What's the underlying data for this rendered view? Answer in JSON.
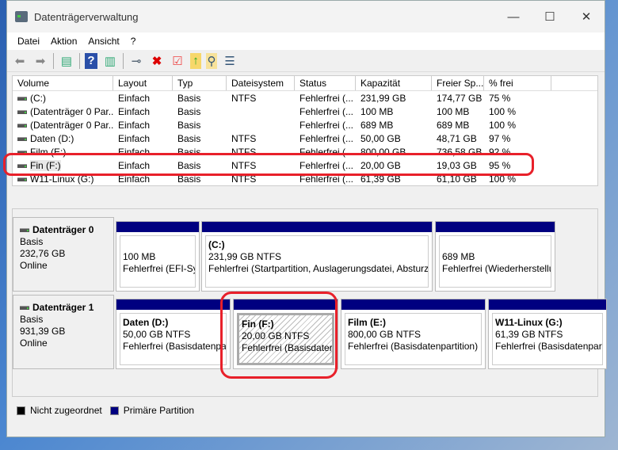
{
  "window": {
    "title": "Datenträgerverwaltung",
    "minimize": "—",
    "maximize": "☐",
    "close": "✕"
  },
  "menu": [
    "Datei",
    "Aktion",
    "Ansicht",
    "?"
  ],
  "toolbar": [
    "back-icon",
    "forward-icon",
    "show-pane-icon",
    "help-icon",
    "show-pane-right-icon",
    "connect-disk-icon",
    "delete-icon",
    "properties-icon",
    "folder-up-icon",
    "search-folder-icon",
    "checklist-icon"
  ],
  "columns": [
    "Volume",
    "Layout",
    "Typ",
    "Dateisystem",
    "Status",
    "Kapazität",
    "Freier Sp...",
    "% frei"
  ],
  "volumes": [
    [
      "(C:)",
      "Einfach",
      "Basis",
      "NTFS",
      "Fehlerfrei (...",
      "231,99 GB",
      "174,77 GB",
      "75 %"
    ],
    [
      "(Datenträger 0 Par...",
      "Einfach",
      "Basis",
      "",
      "Fehlerfrei (...",
      "100 MB",
      "100 MB",
      "100 %"
    ],
    [
      "(Datenträger 0 Par...",
      "Einfach",
      "Basis",
      "",
      "Fehlerfrei (...",
      "689 MB",
      "689 MB",
      "100 %"
    ],
    [
      "Daten (D:)",
      "Einfach",
      "Basis",
      "NTFS",
      "Fehlerfrei (...",
      "50,00 GB",
      "48,71 GB",
      "97 %"
    ],
    [
      "Film (E:)",
      "Einfach",
      "Basis",
      "NTFS",
      "Fehlerfrei (...",
      "800,00 GB",
      "736,58 GB",
      "92 %"
    ],
    [
      "Fin (F:)",
      "Einfach",
      "Basis",
      "NTFS",
      "Fehlerfrei (...",
      "20,00 GB",
      "19,03 GB",
      "95 %"
    ],
    [
      "W11-Linux (G:)",
      "Einfach",
      "Basis",
      "NTFS",
      "Fehlerfrei (...",
      "61,39 GB",
      "61,10 GB",
      "100 %"
    ]
  ],
  "disks": [
    {
      "name": "Datenträger 0",
      "type": "Basis",
      "size": "232,76 GB",
      "status": "Online",
      "partitions": [
        {
          "name": "",
          "size": "100 MB",
          "status": "Fehlerfrei (EFI-Systempartition)"
        },
        {
          "name": "(C:)",
          "size": "231,99 GB NTFS",
          "status": "Fehlerfrei (Startpartition, Auslagerungsdatei, Absturzabbild, Basisdatenpartition)"
        },
        {
          "name": "",
          "size": "689 MB",
          "status": "Fehlerfrei (Wiederherstellungspartition)"
        }
      ]
    },
    {
      "name": "Datenträger 1",
      "type": "Basis",
      "size": "931,39 GB",
      "status": "Online",
      "partitions": [
        {
          "name": "Daten  (D:)",
          "size": "50,00 GB NTFS",
          "status": "Fehlerfrei (Basisdatenpartition)"
        },
        {
          "name": "Fin  (F:)",
          "size": "20,00 GB NTFS",
          "status": "Fehlerfrei (Basisdatenpartition)"
        },
        {
          "name": "Film  (E:)",
          "size": "800,00 GB NTFS",
          "status": "Fehlerfrei (Basisdatenpartition)"
        },
        {
          "name": "W11-Linux  (G:)",
          "size": "61,39 GB NTFS",
          "status": "Fehlerfrei (Basisdatenpartition)"
        }
      ]
    }
  ],
  "legend": [
    {
      "label": "Nicht zugeordnet",
      "color": "#000000"
    },
    {
      "label": "Primäre Partition",
      "color": "#000080"
    }
  ],
  "colors": {
    "primary_partition": "#000080",
    "annotation": "#e8202a"
  }
}
